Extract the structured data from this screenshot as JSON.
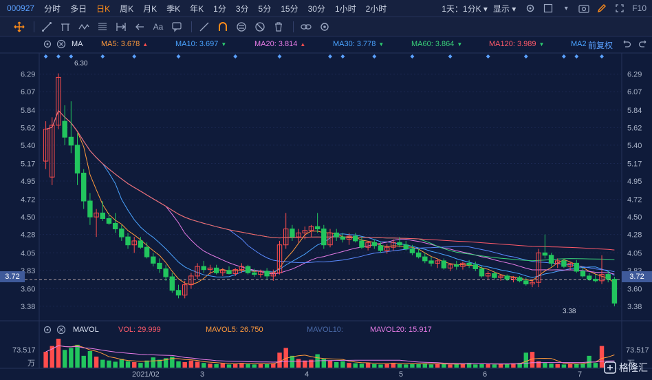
{
  "toolbar": {
    "code": "000927",
    "timeframes": [
      {
        "label": "分时",
        "active": false
      },
      {
        "label": "多日",
        "active": false
      },
      {
        "label": "日K",
        "active": true
      },
      {
        "label": "周K",
        "active": false
      },
      {
        "label": "月K",
        "active": false
      },
      {
        "label": "季K",
        "active": false
      },
      {
        "label": "年K",
        "active": false
      },
      {
        "label": "1分",
        "active": false
      },
      {
        "label": "3分",
        "active": false
      },
      {
        "label": "5分",
        "active": false
      },
      {
        "label": "15分",
        "active": false
      },
      {
        "label": "30分",
        "active": false
      },
      {
        "label": "1小时",
        "active": false
      },
      {
        "label": "2小时",
        "active": false
      }
    ],
    "interval_dropdown": "1天：1分K",
    "display_dropdown": "显示",
    "f10": "F10"
  },
  "main_legend": {
    "indicator": "MA",
    "items": [
      {
        "label": "MA5: 3.678",
        "arrow": "▲",
        "color": "#ff9a3c",
        "arrow_color": "#ff4d4d"
      },
      {
        "label": "MA10: 3.697",
        "arrow": "▼",
        "color": "#4aa3ff",
        "arrow_color": "#2ecc71"
      },
      {
        "label": "MA20: 3.814",
        "arrow": "▲",
        "color": "#e87ce8",
        "arrow_color": "#ff4d4d"
      },
      {
        "label": "MA30: 3.778",
        "arrow": "▼",
        "color": "#4aa3ff",
        "arrow_color": "#2ecc71"
      },
      {
        "label": "MA60: 3.864",
        "arrow": "▼",
        "color": "#3ad27a",
        "arrow_color": "#2ecc71"
      },
      {
        "label": "MA120: 3.989",
        "arrow": "▼",
        "color": "#ff5a6a",
        "arrow_color": "#2ecc71"
      },
      {
        "label": "MA2",
        "arrow": "",
        "color": "#4aa3ff",
        "arrow_color": "#2ecc71"
      }
    ],
    "adjust": "前复权"
  },
  "vol_legend": {
    "indicator": "MAVOL",
    "items": [
      {
        "label": "VOL: 29.999",
        "color": "#ff5a6a"
      },
      {
        "label": "MAVOL5: 26.750",
        "color": "#ff9a3c"
      },
      {
        "label": "MAVOL10:",
        "color": "#4a6aa8"
      },
      {
        "label": "MAVOL20: 15.917",
        "color": "#e87ce8"
      }
    ]
  },
  "y_axis_labels": [
    "6.29",
    "6.07",
    "5.84",
    "5.62",
    "5.40",
    "5.17",
    "4.95",
    "4.72",
    "4.50",
    "4.28",
    "4.05",
    "3.83",
    "3.60",
    "3.38"
  ],
  "current_price_label": "3.72",
  "vol_axis": {
    "max": "73.517",
    "unit": "万"
  },
  "x_axis_labels": [
    "2021/02",
    "3",
    "4",
    "5",
    "6",
    "7"
  ],
  "annotations": {
    "high": "6.30",
    "low": "3.38"
  },
  "watermark": "格隆汇",
  "colors": {
    "up": "#ff4d4d",
    "down": "#22c55e",
    "accent": "#ff8c1a",
    "bg": "#0f1b3a"
  },
  "chart_data": {
    "type": "candlestick",
    "ylim": [
      3.25,
      6.4
    ],
    "volume_max": 73.517,
    "candles": [
      {
        "o": 5.2,
        "h": 5.7,
        "l": 5.1,
        "c": 5.6
      },
      {
        "o": 5.0,
        "h": 5.75,
        "l": 4.9,
        "c": 5.65
      },
      {
        "o": 5.65,
        "h": 6.3,
        "l": 5.6,
        "c": 6.25
      },
      {
        "o": 5.7,
        "h": 5.9,
        "l": 5.4,
        "c": 5.5
      },
      {
        "o": 5.5,
        "h": 5.95,
        "l": 5.3,
        "c": 5.4
      },
      {
        "o": 5.4,
        "h": 5.55,
        "l": 4.9,
        "c": 5.05
      },
      {
        "o": 5.05,
        "h": 5.1,
        "l": 4.6,
        "c": 4.7
      },
      {
        "o": 4.7,
        "h": 4.8,
        "l": 4.4,
        "c": 4.5
      },
      {
        "o": 4.5,
        "h": 4.6,
        "l": 4.25,
        "c": 4.55
      },
      {
        "o": 4.55,
        "h": 4.7,
        "l": 4.45,
        "c": 4.48
      },
      {
        "o": 4.48,
        "h": 4.55,
        "l": 4.4,
        "c": 4.42
      },
      {
        "o": 4.42,
        "h": 4.55,
        "l": 4.3,
        "c": 4.35
      },
      {
        "o": 4.35,
        "h": 4.4,
        "l": 4.2,
        "c": 4.25
      },
      {
        "o": 4.25,
        "h": 4.3,
        "l": 4.1,
        "c": 4.15
      },
      {
        "o": 4.15,
        "h": 4.25,
        "l": 4.05,
        "c": 4.2
      },
      {
        "o": 4.2,
        "h": 4.25,
        "l": 4.1,
        "c": 4.12
      },
      {
        "o": 4.12,
        "h": 4.18,
        "l": 3.98,
        "c": 4.0
      },
      {
        "o": 4.0,
        "h": 4.05,
        "l": 3.88,
        "c": 3.92
      },
      {
        "o": 3.92,
        "h": 3.98,
        "l": 3.8,
        "c": 3.85
      },
      {
        "o": 3.85,
        "h": 3.9,
        "l": 3.7,
        "c": 3.75
      },
      {
        "o": 3.75,
        "h": 3.8,
        "l": 3.55,
        "c": 3.58
      },
      {
        "o": 3.58,
        "h": 3.65,
        "l": 3.48,
        "c": 3.52
      },
      {
        "o": 3.52,
        "h": 3.7,
        "l": 3.48,
        "c": 3.65
      },
      {
        "o": 3.65,
        "h": 3.8,
        "l": 3.6,
        "c": 3.76
      },
      {
        "o": 3.76,
        "h": 3.92,
        "l": 3.72,
        "c": 3.88
      },
      {
        "o": 3.88,
        "h": 3.95,
        "l": 3.8,
        "c": 3.84
      },
      {
        "o": 3.84,
        "h": 3.9,
        "l": 3.78,
        "c": 3.86
      },
      {
        "o": 3.86,
        "h": 3.9,
        "l": 3.78,
        "c": 3.8
      },
      {
        "o": 3.8,
        "h": 3.86,
        "l": 3.76,
        "c": 3.83
      },
      {
        "o": 3.83,
        "h": 3.88,
        "l": 3.78,
        "c": 3.79
      },
      {
        "o": 3.79,
        "h": 3.86,
        "l": 3.76,
        "c": 3.84
      },
      {
        "o": 3.84,
        "h": 3.92,
        "l": 3.8,
        "c": 3.88
      },
      {
        "o": 3.88,
        "h": 3.9,
        "l": 3.78,
        "c": 3.8
      },
      {
        "o": 3.8,
        "h": 3.85,
        "l": 3.75,
        "c": 3.78
      },
      {
        "o": 3.78,
        "h": 3.84,
        "l": 3.74,
        "c": 3.82
      },
      {
        "o": 3.82,
        "h": 3.86,
        "l": 3.72,
        "c": 3.76
      },
      {
        "o": 3.76,
        "h": 3.84,
        "l": 3.7,
        "c": 3.8
      },
      {
        "o": 3.8,
        "h": 4.2,
        "l": 3.78,
        "c": 4.15
      },
      {
        "o": 4.15,
        "h": 4.55,
        "l": 4.1,
        "c": 4.35
      },
      {
        "o": 4.35,
        "h": 4.4,
        "l": 4.2,
        "c": 4.25
      },
      {
        "o": 4.25,
        "h": 4.35,
        "l": 4.18,
        "c": 4.3
      },
      {
        "o": 4.3,
        "h": 4.38,
        "l": 4.22,
        "c": 4.33
      },
      {
        "o": 4.33,
        "h": 4.4,
        "l": 4.25,
        "c": 4.38
      },
      {
        "o": 4.38,
        "h": 4.55,
        "l": 4.3,
        "c": 4.35
      },
      {
        "o": 4.35,
        "h": 4.4,
        "l": 4.1,
        "c": 4.15
      },
      {
        "o": 4.15,
        "h": 4.35,
        "l": 4.12,
        "c": 4.3
      },
      {
        "o": 4.3,
        "h": 4.35,
        "l": 4.2,
        "c": 4.25
      },
      {
        "o": 4.25,
        "h": 4.3,
        "l": 4.18,
        "c": 4.22
      },
      {
        "o": 4.22,
        "h": 4.3,
        "l": 4.15,
        "c": 4.26
      },
      {
        "o": 4.26,
        "h": 4.3,
        "l": 4.18,
        "c": 4.2
      },
      {
        "o": 4.2,
        "h": 4.25,
        "l": 4.1,
        "c": 4.12
      },
      {
        "o": 4.12,
        "h": 4.2,
        "l": 4.08,
        "c": 4.18
      },
      {
        "o": 4.18,
        "h": 4.22,
        "l": 4.1,
        "c": 4.14
      },
      {
        "o": 4.14,
        "h": 4.18,
        "l": 4.05,
        "c": 4.08
      },
      {
        "o": 4.08,
        "h": 4.16,
        "l": 4.04,
        "c": 4.12
      },
      {
        "o": 4.12,
        "h": 4.22,
        "l": 4.08,
        "c": 4.18
      },
      {
        "o": 4.18,
        "h": 4.25,
        "l": 4.12,
        "c": 4.15
      },
      {
        "o": 4.15,
        "h": 4.2,
        "l": 4.08,
        "c": 4.1
      },
      {
        "o": 4.1,
        "h": 4.15,
        "l": 4.02,
        "c": 4.05
      },
      {
        "o": 4.05,
        "h": 4.1,
        "l": 3.98,
        "c": 4.0
      },
      {
        "o": 4.0,
        "h": 4.05,
        "l": 3.92,
        "c": 3.95
      },
      {
        "o": 3.95,
        "h": 4.0,
        "l": 3.88,
        "c": 3.92
      },
      {
        "o": 3.92,
        "h": 3.98,
        "l": 3.86,
        "c": 3.95
      },
      {
        "o": 3.95,
        "h": 3.98,
        "l": 3.84,
        "c": 3.86
      },
      {
        "o": 3.86,
        "h": 3.92,
        "l": 3.82,
        "c": 3.9
      },
      {
        "o": 3.9,
        "h": 3.95,
        "l": 3.84,
        "c": 3.88
      },
      {
        "o": 3.88,
        "h": 3.94,
        "l": 3.84,
        "c": 3.92
      },
      {
        "o": 3.92,
        "h": 3.96,
        "l": 3.86,
        "c": 3.9
      },
      {
        "o": 3.9,
        "h": 3.94,
        "l": 3.82,
        "c": 3.85
      },
      {
        "o": 3.85,
        "h": 3.88,
        "l": 3.74,
        "c": 3.76
      },
      {
        "o": 3.76,
        "h": 3.82,
        "l": 3.72,
        "c": 3.79
      },
      {
        "o": 3.79,
        "h": 3.82,
        "l": 3.72,
        "c": 3.74
      },
      {
        "o": 3.74,
        "h": 3.78,
        "l": 3.7,
        "c": 3.76
      },
      {
        "o": 3.76,
        "h": 3.78,
        "l": 3.7,
        "c": 3.72
      },
      {
        "o": 3.72,
        "h": 3.76,
        "l": 3.68,
        "c": 3.74
      },
      {
        "o": 3.74,
        "h": 3.76,
        "l": 3.68,
        "c": 3.7
      },
      {
        "o": 3.7,
        "h": 3.74,
        "l": 3.64,
        "c": 3.66
      },
      {
        "o": 3.66,
        "h": 3.72,
        "l": 3.62,
        "c": 3.68
      },
      {
        "o": 3.68,
        "h": 4.1,
        "l": 3.62,
        "c": 4.05
      },
      {
        "o": 4.05,
        "h": 4.28,
        "l": 3.98,
        "c": 4.02
      },
      {
        "o": 4.02,
        "h": 4.05,
        "l": 3.88,
        "c": 3.92
      },
      {
        "o": 3.92,
        "h": 3.98,
        "l": 3.86,
        "c": 3.95
      },
      {
        "o": 3.95,
        "h": 3.98,
        "l": 3.86,
        "c": 3.88
      },
      {
        "o": 3.88,
        "h": 3.94,
        "l": 3.84,
        "c": 3.92
      },
      {
        "o": 3.92,
        "h": 3.96,
        "l": 3.8,
        "c": 3.82
      },
      {
        "o": 3.82,
        "h": 3.86,
        "l": 3.74,
        "c": 3.76
      },
      {
        "o": 3.76,
        "h": 3.8,
        "l": 3.7,
        "c": 3.72
      },
      {
        "o": 3.72,
        "h": 3.78,
        "l": 3.68,
        "c": 3.7
      },
      {
        "o": 3.7,
        "h": 4.02,
        "l": 3.66,
        "c": 3.78
      },
      {
        "o": 3.78,
        "h": 3.82,
        "l": 3.68,
        "c": 3.72
      },
      {
        "o": 3.72,
        "h": 3.75,
        "l": 3.38,
        "c": 3.42
      }
    ],
    "volume": [
      40,
      55,
      73.5,
      45,
      50,
      58,
      30,
      42,
      28,
      20,
      18,
      15,
      22,
      16,
      14,
      12,
      18,
      26,
      20,
      24,
      28,
      16,
      14,
      18,
      15,
      12,
      10,
      9,
      11,
      8,
      10,
      12,
      9,
      8,
      10,
      9,
      11,
      38,
      50,
      30,
      22,
      18,
      20,
      34,
      22,
      18,
      14,
      16,
      12,
      11,
      10,
      12,
      9,
      8,
      10,
      12,
      9,
      8,
      10,
      9,
      11,
      8,
      10,
      9,
      8,
      10,
      9,
      12,
      8,
      10,
      9,
      8,
      10,
      9,
      11,
      12,
      38,
      40,
      16,
      12,
      10,
      9,
      8,
      10,
      9,
      11,
      30,
      12,
      55
    ]
  }
}
